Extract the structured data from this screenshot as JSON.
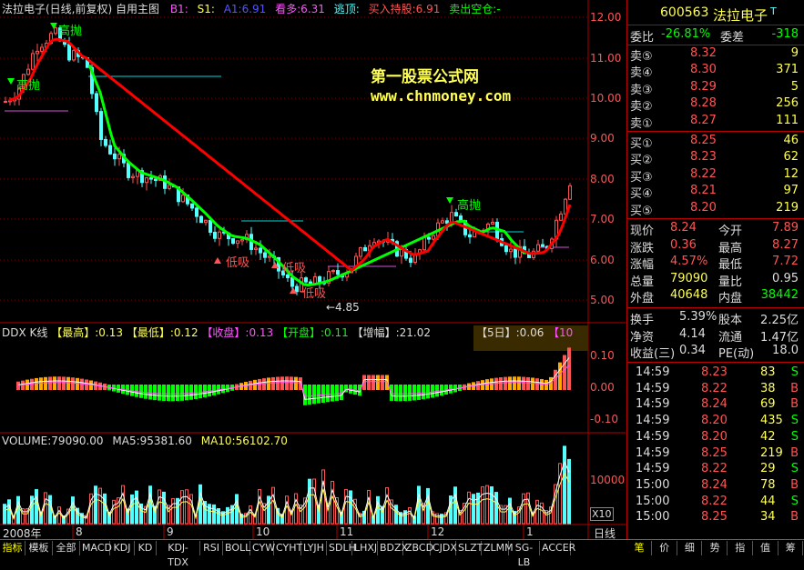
{
  "header": {
    "title": "法拉电子(日线,前复权) 自用主图",
    "b1": "B1:",
    "s1": "S1:",
    "a1": "A1:6.91",
    "kanduo": "看多:6.31",
    "taoding": "逃顶:",
    "buy_hold": "买入持股:6.91",
    "sell": "卖出空仓:-"
  },
  "watermark": {
    "line1": "第一股票公式网",
    "line2": "www.chnmoney.com"
  },
  "price_axis": [
    "12.00",
    "11.00",
    "10.00",
    "9.00",
    "8.00",
    "7.00",
    "6.00",
    "5.00"
  ],
  "annotations": {
    "high": "高抛",
    "low": "低吸",
    "min_price": "←4.85"
  },
  "ddx": {
    "title": "DDX K线",
    "items": [
      "【最高】:0.13",
      "【最低】:0.12",
      "【收盘】:0.13",
      "【开盘】:0.11",
      "【增幅】:21.02"
    ],
    "right": "【5日】:0.06",
    "right2": "【10",
    "axis": [
      "0.10",
      "0.00",
      "-0.10"
    ]
  },
  "volume": {
    "label": "VOLUME:79090.00",
    "ma5": "MA5:95381.60",
    "ma10": "MA10:56102.70",
    "axis": "10000",
    "x10": "X10"
  },
  "date_axis": {
    "year": "2008年",
    "months": [
      "8",
      "9",
      "10",
      "11",
      "12",
      "1"
    ],
    "period": "日线"
  },
  "quote": {
    "code": "600563",
    "name": "法拉电子",
    "flag": "T",
    "weibi_label": "委比",
    "weibi": "-26.81%",
    "weicha_label": "委差",
    "weicha": "-318",
    "sells": [
      {
        "label": "卖⑤",
        "price": "8.32",
        "vol": "9"
      },
      {
        "label": "卖④",
        "price": "8.30",
        "vol": "371"
      },
      {
        "label": "卖③",
        "price": "8.29",
        "vol": "5"
      },
      {
        "label": "卖②",
        "price": "8.28",
        "vol": "256"
      },
      {
        "label": "卖①",
        "price": "8.27",
        "vol": "111"
      }
    ],
    "buys": [
      {
        "label": "买①",
        "price": "8.25",
        "vol": "46"
      },
      {
        "label": "买②",
        "price": "8.23",
        "vol": "62"
      },
      {
        "label": "买③",
        "price": "8.22",
        "vol": "12"
      },
      {
        "label": "买④",
        "price": "8.21",
        "vol": "97"
      },
      {
        "label": "买⑤",
        "price": "8.20",
        "vol": "219"
      }
    ],
    "stats": [
      {
        "l1": "现价",
        "v1": "8.24",
        "l2": "今开",
        "v2": "7.89"
      },
      {
        "l1": "涨跌",
        "v1": "0.36",
        "l2": "最高",
        "v2": "8.27"
      },
      {
        "l1": "涨幅",
        "v1": "4.57%",
        "l2": "最低",
        "v2": "7.72"
      },
      {
        "l1": "总量",
        "v1": "79090",
        "l2": "量比",
        "v2": "0.95"
      },
      {
        "l1": "外盘",
        "v1": "40648",
        "l2": "内盘",
        "v2": "38442"
      }
    ],
    "stats2": [
      {
        "l1": "换手",
        "v1": "5.39%",
        "l2": "股本",
        "v2": "2.25亿"
      },
      {
        "l1": "净资",
        "v1": "4.14",
        "l2": "流通",
        "v2": "1.47亿"
      },
      {
        "l1": "收益(三)",
        "v1": "0.34",
        "l2": "PE(动)",
        "v2": "18.0"
      }
    ],
    "ticks": [
      {
        "t": "14:59",
        "p": "8.23",
        "v": "83",
        "s": "S"
      },
      {
        "t": "14:59",
        "p": "8.22",
        "v": "38",
        "s": "B"
      },
      {
        "t": "14:59",
        "p": "8.24",
        "v": "69",
        "s": "B"
      },
      {
        "t": "14:59",
        "p": "8.20",
        "v": "435",
        "s": "S"
      },
      {
        "t": "14:59",
        "p": "8.20",
        "v": "42",
        "s": "S"
      },
      {
        "t": "14:59",
        "p": "8.25",
        "v": "219",
        "s": "B"
      },
      {
        "t": "14:59",
        "p": "8.22",
        "v": "29",
        "s": "S"
      },
      {
        "t": "15:00",
        "p": "8.24",
        "v": "78",
        "s": "B"
      },
      {
        "t": "15:00",
        "p": "8.22",
        "v": "44",
        "s": "S"
      },
      {
        "t": "15:00",
        "p": "8.25",
        "v": "34",
        "s": "B"
      }
    ]
  },
  "tabs": [
    "指标",
    "模板",
    "全部",
    "MACD",
    "KDJ",
    "KD",
    "KDJ-TDX",
    "RSI",
    "BOLL",
    "CYW",
    "CYHT",
    "LYJH",
    "SDLH",
    "LHXJ",
    "BDZX",
    "ZBCD",
    "CJDX",
    "SLZT",
    "ZLMM",
    "SG-LB",
    "ACCER"
  ],
  "right_tabs": [
    "笔",
    "价",
    "细",
    "势",
    "指",
    "值",
    "筹"
  ],
  "colors": {
    "up": "#ff5454",
    "down": "#54ffff",
    "ma_green": "#00ff00",
    "ma_red": "#ff0000",
    "axis": "#b00000",
    "yellow": "#ffff00",
    "magenta": "#ff54ff"
  }
}
